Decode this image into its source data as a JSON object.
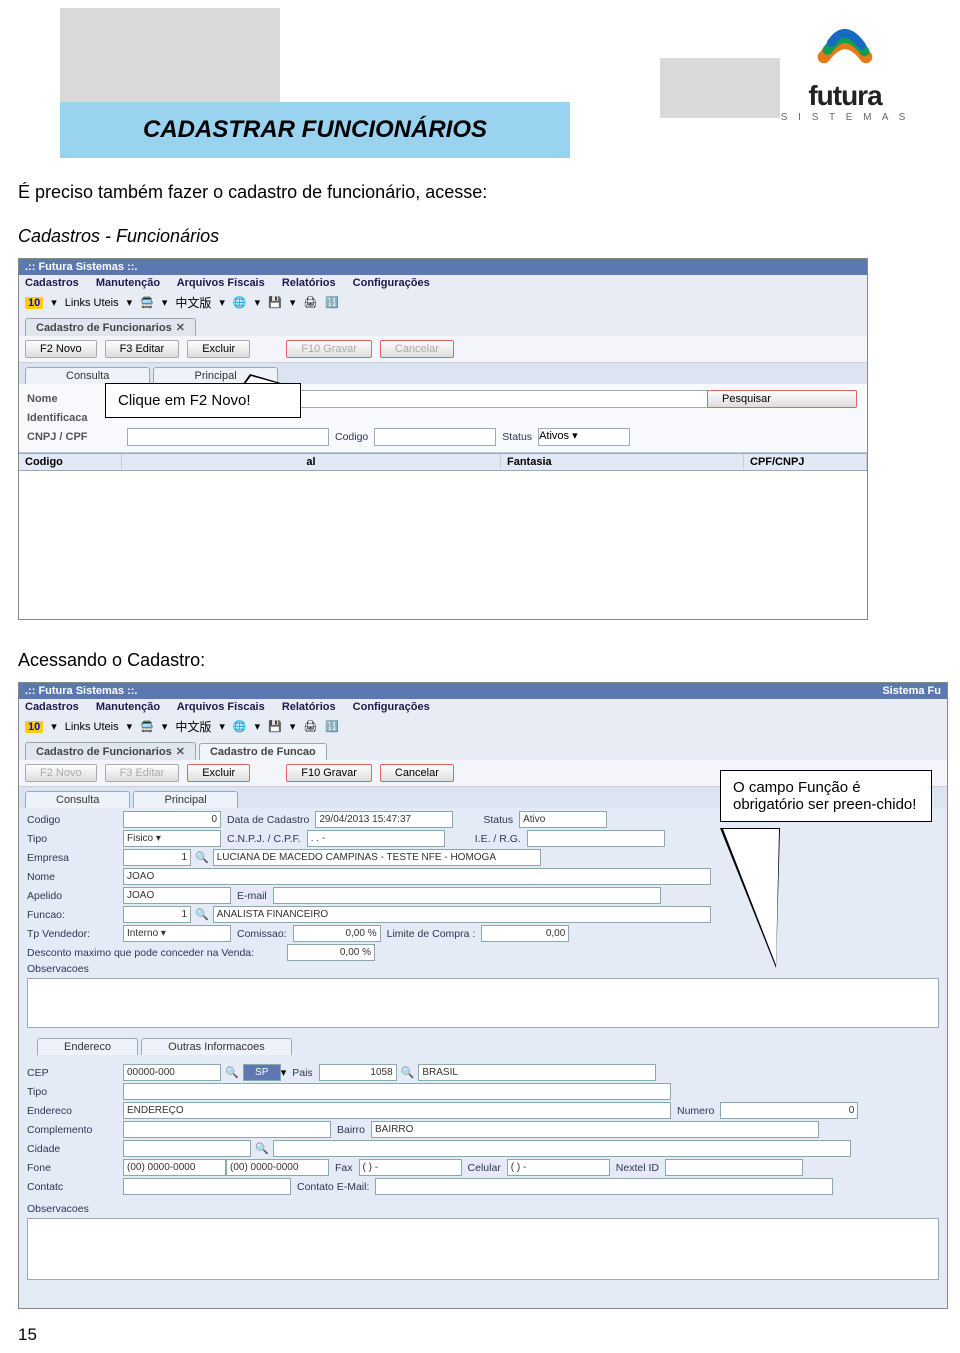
{
  "header": {
    "title": "CADASTRAR FUNCIONÁRIOS",
    "logo_name": "futura",
    "logo_sub": "S I S T E M A S"
  },
  "intro": {
    "line1": "É preciso também fazer o cadastro de funcionário, acesse:",
    "line2": "Cadastros - Funcionários"
  },
  "shot1": {
    "title": ".:: Futura Sistemas ::.",
    "menu": [
      "Cadastros",
      "Manutenção",
      "Arquivos Fiscais",
      "Relatórios",
      "Configurações"
    ],
    "toolbar_10": "10",
    "toolbar_links": "Links Uteis",
    "toolbar_cjk": "中文版",
    "tab": "Cadastro de Funcionarios",
    "buttons": {
      "novo": "F2 Novo",
      "editar": "F3 Editar",
      "excluir": "Excluir",
      "gravar": "F10 Gravar",
      "cancelar": "Cancelar"
    },
    "subtabs": {
      "consulta": "Consulta",
      "principal": "Principal"
    },
    "filters": {
      "nome_label": "Nome",
      "identificacao_label": "Identificaca",
      "cnpj_label": "CNPJ / CPF",
      "codigo_label": "Codigo",
      "status_label": "Status",
      "status_value": "Ativos",
      "pesquisar": "Pesquisar"
    },
    "grid": {
      "codigo": "Codigo",
      "al": "al",
      "fantasia": "Fantasia",
      "cpf": "CPF/CNPJ"
    }
  },
  "callout1": "Clique em F2 Novo!",
  "between": "Acessando o Cadastro:",
  "shot2": {
    "title": ".:: Futura Sistemas ::.",
    "title_right": "Sistema Fu",
    "menu": [
      "Cadastros",
      "Manutenção",
      "Arquivos Fiscais",
      "Relatórios",
      "Configurações"
    ],
    "toolbar_10": "10",
    "toolbar_links": "Links Uteis",
    "toolbar_cjk": "中文版",
    "tab1": "Cadastro de Funcionarios",
    "tab2": "Cadastro de Funcao",
    "buttons": {
      "novo": "F2 Novo",
      "editar": "F3 Editar",
      "excluir": "Excluir",
      "gravar": "F10 Gravar",
      "cancelar": "Cancelar"
    },
    "subtabs": {
      "consulta": "Consulta",
      "principal": "Principal"
    },
    "form": {
      "codigo_label": "Codigo",
      "codigo_val": "0",
      "datacad_label": "Data de Cadastro",
      "datacad_val": "29/04/2013 15:47:37",
      "status_label": "Status",
      "status_val": "Ativo",
      "tipo_label": "Tipo",
      "tipo_val": "Fisico",
      "cnpj_label": "C.N.P.J. / C.P.F.",
      "cnpj_val": "   .     .     -",
      "ie_label": "I.E. / R.G.",
      "ie_val": "",
      "empresa_label": "Empresa",
      "empresa_code": "1",
      "empresa_val": "LUCIANA DE MACEDO CAMPINAS - TESTE NFE - HOMOGA",
      "nome_label": "Nome",
      "nome_val": "JOAO",
      "apelido_label": "Apelido",
      "apelido_val": "JOAO",
      "email_label": "E-mail",
      "email_val": "",
      "funcao_label": "Funcao:",
      "funcao_code": "1",
      "funcao_val": "ANALISTA FINANCEIRO",
      "tpvend_label": "Tp Vendedor:",
      "tpvend_val": "Interno",
      "comissao_label": "Comissao:",
      "comissao_val": "0,00 %",
      "limite_label": "Limite de Compra :",
      "limite_val": "0,00",
      "descmax_label": "Desconto maximo que pode conceder na Venda:",
      "descmax_val": "0,00 %",
      "obs_label": "Observacoes"
    },
    "section_tabs": {
      "endereco": "Endereco",
      "outras": "Outras Informacoes"
    },
    "endereco": {
      "cep_label": "CEP",
      "cep_val": "00000-000",
      "uf_val": "SP",
      "pais_label": "Pais",
      "pais_code": "1058",
      "pais_val": "BRASIL",
      "tipo_label": "Tipo",
      "tipo_val": "",
      "endereco_label": "Endereco",
      "endereco_val": "ENDEREÇO",
      "numero_label": "Numero",
      "numero_val": "0",
      "complemento_label": "Complemento",
      "complemento_val": "",
      "bairro_label": "Bairro",
      "bairro_val": "BAIRRO",
      "cidade_label": "Cidade",
      "cidade_val": "",
      "fone_label": "Fone",
      "fone_val1": "(00) 0000-0000",
      "fone_val2": "(00) 0000-0000",
      "fax_label": "Fax",
      "fax_val": "(  )      -",
      "celular_label": "Celular",
      "celular_val": "(  )      -",
      "nextel_label": "Nextel ID",
      "nextel_val": "",
      "contatc_label": "Contatc",
      "contatc_val": "",
      "contato_email_label": "Contato E-Mail:",
      "contato_email_val": "",
      "obs_label": "Observacoes"
    }
  },
  "callout2": "O campo Função é obrigatório ser preen-chido!",
  "page_no": "15"
}
